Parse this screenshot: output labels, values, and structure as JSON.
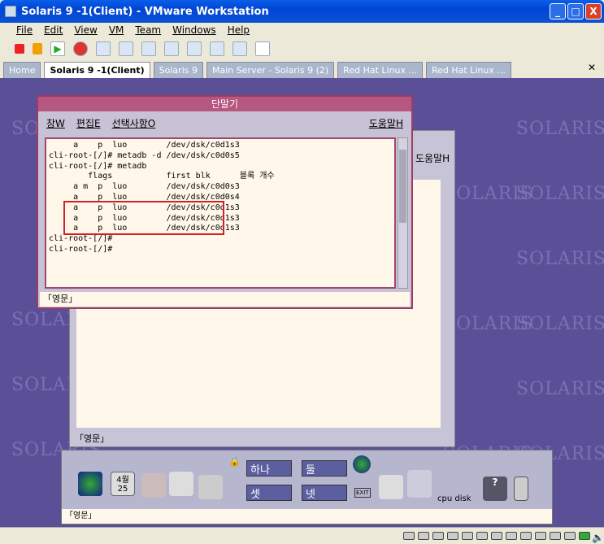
{
  "window": {
    "title": "Solaris 9 -1(Client) - VMware Workstation"
  },
  "menu": [
    "File",
    "Edit",
    "View",
    "VM",
    "Team",
    "Windows",
    "Help"
  ],
  "tabs": [
    {
      "label": "Home"
    },
    {
      "label": "Solaris 9 -1(Client)",
      "active": true
    },
    {
      "label": "Solaris 9"
    },
    {
      "label": "Main Server - Solaris 9 (2)"
    },
    {
      "label": "Red Hat Linux ..."
    },
    {
      "label": "Red Hat Linux ..."
    }
  ],
  "desktop": {
    "watermark": "SOLARIS"
  },
  "bg_window": {
    "help": "도움말H",
    "status": "「영문」"
  },
  "terminal": {
    "title": "단말기",
    "menu": [
      "창W",
      "편집E",
      "선택사항O"
    ],
    "help": "도움말H",
    "lines": [
      "     a    p  luo        /dev/dsk/c0d1s3",
      "cli-root-[/]# metadb -d /dev/dsk/c0d0s5",
      "cli-root-[/]# metadb",
      "        flags           first blk      블록 개수",
      "     a m  p  luo        /dev/dsk/c0d0s3",
      "     a    p  luo        /dev/dsk/c0d0s4",
      "     a    p  luo        /dev/dsk/c0d1s3",
      "     a    p  luo        /dev/dsk/c0d1s3",
      "     a    p  luo        /dev/dsk/c0d1s3",
      "cli-root-[/]#",
      "cli-root-[/]#"
    ],
    "status": "「영문」"
  },
  "panel": {
    "cal_month": "4월",
    "cal_day": "25",
    "ws": [
      "하나",
      "둘",
      "셋",
      "넷"
    ],
    "exit": "EXIT",
    "meter": "cpu disk",
    "help": "?",
    "status": "「영문」"
  }
}
